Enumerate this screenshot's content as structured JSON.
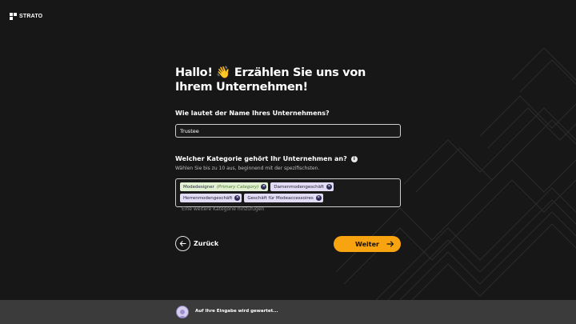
{
  "brand": {
    "name": "STRATO"
  },
  "heading": {
    "title": "Hallo! 👋 Erzählen Sie uns von Ihrem Unternehmen!"
  },
  "company_name": {
    "question": "Wie lautet der Name Ihres Unternehmens?",
    "value": "Trustee"
  },
  "category": {
    "question": "Welcher Kategorie gehört Ihr Unternehmen an?",
    "info_glyph": "i",
    "hint": "Wählen Sie bis zu 10 aus, beginnend mit der spezifischsten.",
    "tags": [
      {
        "label": "Modedesigner",
        "sub": "(Primary Category)"
      },
      {
        "label": "Damenmodengeschäft"
      },
      {
        "label": "Herrenmodengeschäft"
      },
      {
        "label": "Geschäft für Modeaccessoires"
      }
    ],
    "remove_glyph": "✕",
    "placeholder": "Eine weitere Kategorie hinzufügen"
  },
  "nav": {
    "back_label": "Zurück",
    "next_label": "Weiter"
  },
  "footer": {
    "status": "Auf Ihre Eingabe wird gewartet..."
  },
  "colors": {
    "background": "#171717",
    "accent": "#f7a410",
    "primary_tag": "#e2f1d3",
    "tag": "#e3dcf6",
    "footer": "#3b3b3b"
  },
  "icons": [
    "strato-logo-icon",
    "info-icon",
    "remove-tag-icon",
    "arrow-left-icon",
    "arrow-right-icon",
    "assistant-avatar"
  ]
}
